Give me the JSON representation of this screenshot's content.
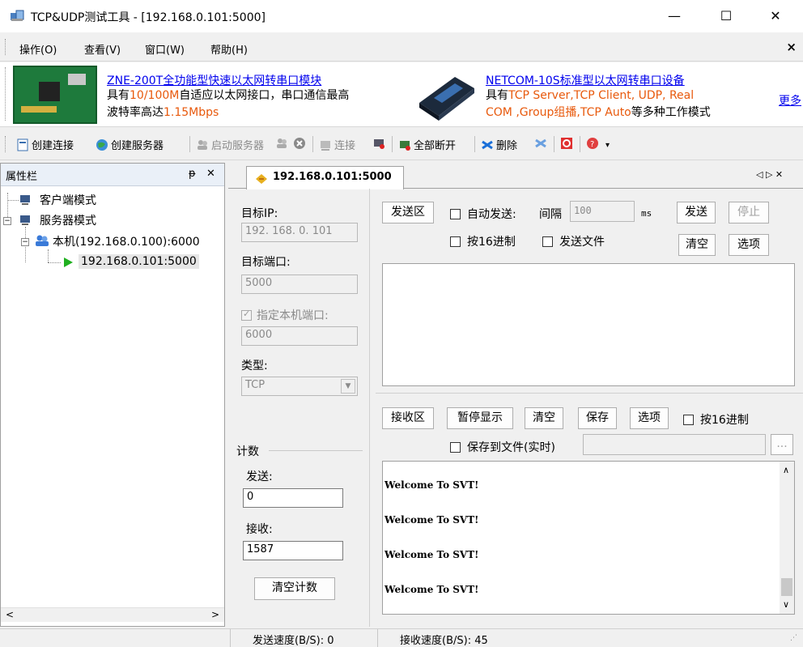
{
  "window": {
    "title": "TCP&UDP测试工具 - [192.168.0.101:5000]",
    "minimize_glyph": "—",
    "maximize_glyph": "☐",
    "close_glyph": "✕"
  },
  "menu": {
    "items": [
      "操作(O)",
      "查看(V)",
      "窗口(W)",
      "帮助(H)"
    ],
    "close_glyph": "×"
  },
  "ads": {
    "ad1": {
      "title": "ZNE-200T全功能型快速以太网转串口模块",
      "line2_a": "具有",
      "line2_b": "10/100M",
      "line2_c": "自适应以太网接口，串口通信最高",
      "line3_a": "波特率高达",
      "line3_b": "1.15Mbps"
    },
    "ad2": {
      "title": "NETCOM-10S标准型以太网转串口设备",
      "line2_a": "具有",
      "line2_b": "TCP Server,TCP Client, UDP, Real",
      "line3_a": "COM ,Group组播,TCP Auto",
      "line3_b": "等多种工作模式"
    },
    "more": "更多"
  },
  "toolbar": {
    "create_conn": "创建连接",
    "create_server": "创建服务器",
    "start_server": "启动服务器",
    "connect": "连接",
    "disconnect_all": "全部断开",
    "delete": "删除"
  },
  "left_panel": {
    "header": "属性栏",
    "pin_glyph": "ᵽ",
    "close_glyph": "✕",
    "tree": {
      "client_mode": "客户端模式",
      "server_mode": "服务器模式",
      "local": "本机(192.168.0.100):6000",
      "session": "192.168.0.101:5000"
    },
    "scroll_left": "<",
    "scroll_right": ">"
  },
  "tab": {
    "label": "192.168.0.101:5000",
    "nav_glyphs": "◁ ▷ ✕"
  },
  "settings": {
    "target_ip_label": "目标IP:",
    "target_ip_value": "192. 168. 0. 101",
    "target_port_label": "目标端口:",
    "target_port_value": "5000",
    "local_port_check_label": "指定本机端口:",
    "local_port_value": "6000",
    "type_label": "类型:",
    "type_value": "TCP",
    "count_label": "计数",
    "sent_label": "发送:",
    "sent_value": "0",
    "recv_label": "接收:",
    "recv_value": "1587",
    "clear_count": "清空计数"
  },
  "send_area": {
    "label": "发送区",
    "auto_send": "自动发送:",
    "interval_label": "间隔",
    "interval_value": "100",
    "ms": "ms",
    "send_btn": "发送",
    "stop_btn": "停止",
    "hex_label": "按16进制",
    "send_file_label": "发送文件",
    "clear_btn": "清空",
    "options_btn": "选项"
  },
  "recv_area": {
    "label": "接收区",
    "pause_btn": "暂停显示",
    "clear_btn": "清空",
    "save_btn": "保存",
    "options_btn": "选项",
    "hex_label": "按16进制",
    "save_to_file_label": "保存到文件(实时)",
    "browse_btn": "...",
    "lines": [
      "Welcome To SVT!",
      "Welcome To SVT!",
      "Welcome To SVT!",
      "Welcome To SVT!"
    ]
  },
  "status": {
    "send_speed": "发送速度(B/S): 0",
    "recv_speed": "接收速度(B/S): 45"
  }
}
